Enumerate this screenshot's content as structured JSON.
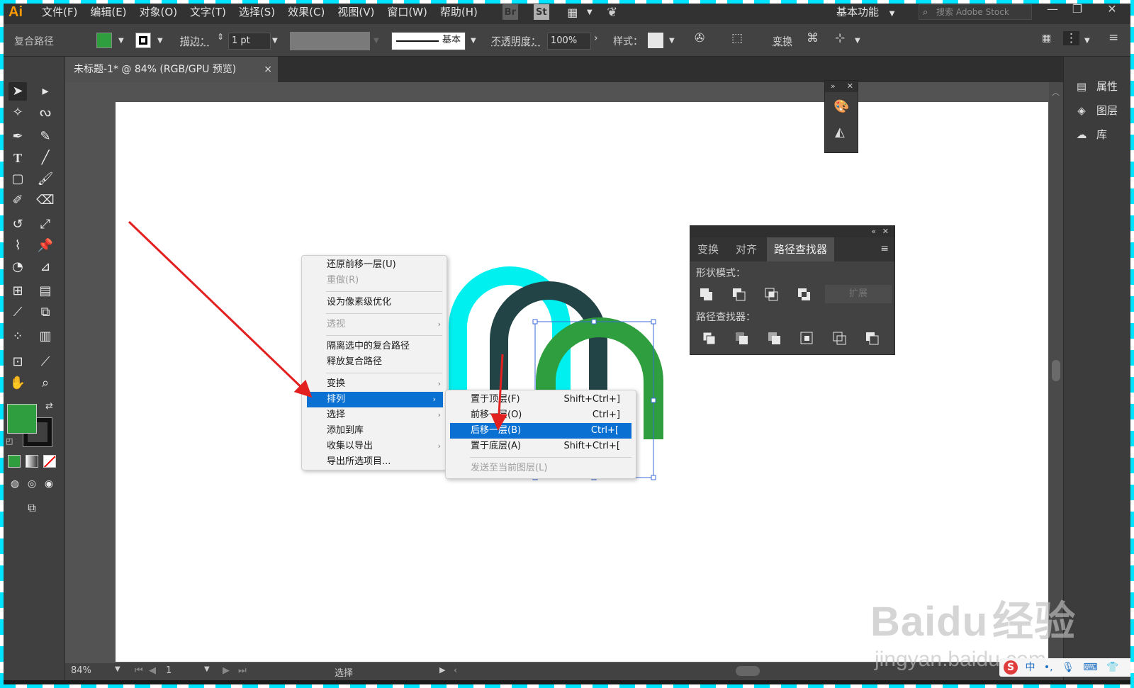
{
  "app": {
    "logo": "Ai",
    "menus": [
      "文件(F)",
      "编辑(E)",
      "对象(O)",
      "文字(T)",
      "选择(S)",
      "效果(C)",
      "视图(V)",
      "窗口(W)",
      "帮助(H)"
    ],
    "bridge_label": "Br",
    "stock_label": "St",
    "workspace": "基本功能",
    "search_placeholder": "搜索 Adobe Stock"
  },
  "control_bar": {
    "selection_type": "复合路径",
    "fill_color": "#2e9e3e",
    "stroke_label": "描边：",
    "stroke_weight": "1 pt",
    "brush_label": "基本",
    "opacity_label": "不透明度：",
    "opacity_value": "100%",
    "style_label": "样式：",
    "transform_label": "变换"
  },
  "document": {
    "tab_title": "未标题-1* @ 84% (RGB/GPU 预览)",
    "tab_close": "×"
  },
  "status_bar": {
    "zoom": "84%",
    "artboard_number": "1",
    "tool_name": "选择"
  },
  "dock": {
    "items": [
      {
        "label": "属性",
        "icon": "properties-icon"
      },
      {
        "label": "图层",
        "icon": "layers-icon"
      },
      {
        "label": "库",
        "icon": "libraries-icon"
      }
    ]
  },
  "pathfinder_panel": {
    "tabs": [
      "变换",
      "对齐",
      "路径查找器"
    ],
    "active_tab": 2,
    "shape_modes_label": "形状模式：",
    "pathfinders_label": "路径查找器：",
    "expand_label": "扩展"
  },
  "context_menu": {
    "items": [
      {
        "label": "还原前移一层(U)",
        "disabled": false
      },
      {
        "label": "重做(R)",
        "disabled": true
      },
      {
        "label": "设为像素级优化",
        "disabled": false
      },
      {
        "label": "透视",
        "disabled": true,
        "submenu": true
      },
      {
        "label": "隔离选中的复合路径",
        "disabled": false
      },
      {
        "label": "释放复合路径",
        "disabled": false
      },
      {
        "label": "变换",
        "disabled": false,
        "submenu": true
      },
      {
        "label": "排列",
        "disabled": false,
        "submenu": true,
        "highlighted": true
      },
      {
        "label": "选择",
        "disabled": false,
        "submenu": true
      },
      {
        "label": "添加到库",
        "disabled": false
      },
      {
        "label": "收集以导出",
        "disabled": false,
        "submenu": true
      },
      {
        "label": "导出所选项目...",
        "disabled": false
      }
    ]
  },
  "arrange_submenu": {
    "items": [
      {
        "label": "置于顶层(F)",
        "shortcut": "Shift+Ctrl+]"
      },
      {
        "label": "前移一层(O)",
        "shortcut": "Ctrl+]"
      },
      {
        "label": "后移一层(B)",
        "shortcut": "Ctrl+[",
        "highlighted": true
      },
      {
        "label": "置于底层(A)",
        "shortcut": "Shift+Ctrl+["
      },
      {
        "label": "发送至当前图层(L)",
        "shortcut": "",
        "disabled": true
      }
    ]
  },
  "artwork": {
    "shapes": [
      {
        "name": "cyan-arch",
        "color": "#00f0f0"
      },
      {
        "name": "dark-teal-arch",
        "color": "#234446"
      },
      {
        "name": "green-arch",
        "color": "#2e9e3e"
      }
    ],
    "annotation_color": "#e32020"
  },
  "ime": {
    "logo": "S",
    "lang": "中"
  },
  "watermark": {
    "brand": "Bai",
    "brand2": "du",
    "cn": "经验",
    "url": "jingyan.baidu.com"
  }
}
